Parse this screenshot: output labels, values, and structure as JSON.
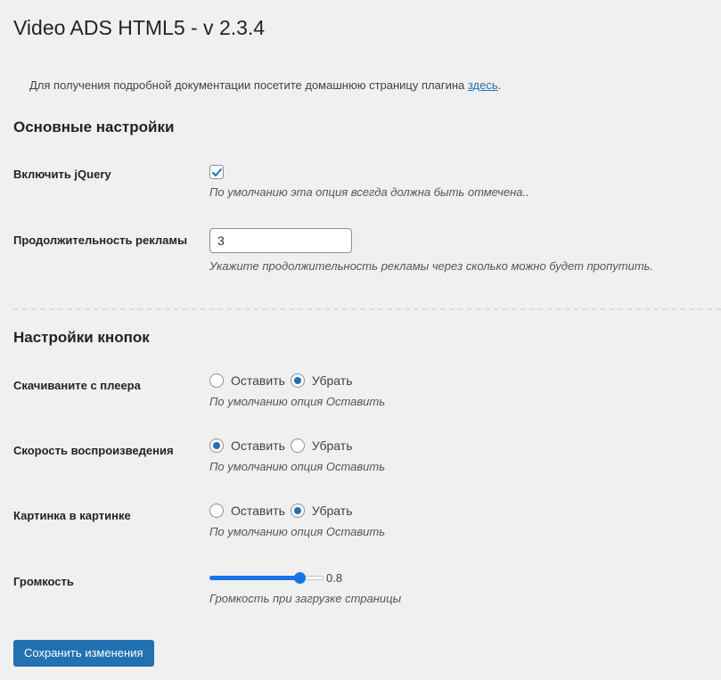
{
  "page": {
    "title": "Video ADS HTML5 - v 2.3.4"
  },
  "doc_note": {
    "text": "Для получения подробной документации посетите домашнюю страницу плагина ",
    "link": "здесь",
    "suffix": "."
  },
  "sections": {
    "main": {
      "title": "Основные настройки"
    },
    "buttons": {
      "title": "Настройки кнопок"
    }
  },
  "settings": {
    "jquery": {
      "label": "Включить jQuery",
      "checked": true,
      "desc": "По умолчанию эта опция всегда должна быть отмечена.."
    },
    "ad_duration": {
      "label": "Продолжительность рекламы",
      "value": "3",
      "desc": "Укажите продолжительность рекламы через сколько можно будет пропутить."
    },
    "download": {
      "label": "Скачиваните с плеера",
      "options": [
        "Оставить",
        "Убрать"
      ],
      "selected": "Убрать",
      "desc": "По умолчанию опция Оставить"
    },
    "speed": {
      "label": "Скорость воспроизведения",
      "options": [
        "Оставить",
        "Убрать"
      ],
      "selected": "Оставить",
      "desc": "По умолчанию опция Оставить"
    },
    "pip": {
      "label": "Картинка в картинке",
      "options": [
        "Оставить",
        "Убрать"
      ],
      "selected": "Убрать",
      "desc": "По умолчанию опция Оставить"
    },
    "volume": {
      "label": "Громкость",
      "value": 0.8,
      "value_text": "0.8",
      "min": 0,
      "max": 1,
      "desc": "Громкость при загрузке страницы"
    }
  },
  "actions": {
    "save_label": "Сохранить изменения"
  },
  "colors": {
    "accent": "#2271b1",
    "slider": "#1a73e8",
    "background": "#f0f0f1"
  },
  "icons": {
    "checkbox_mark": "checkmark-icon"
  }
}
